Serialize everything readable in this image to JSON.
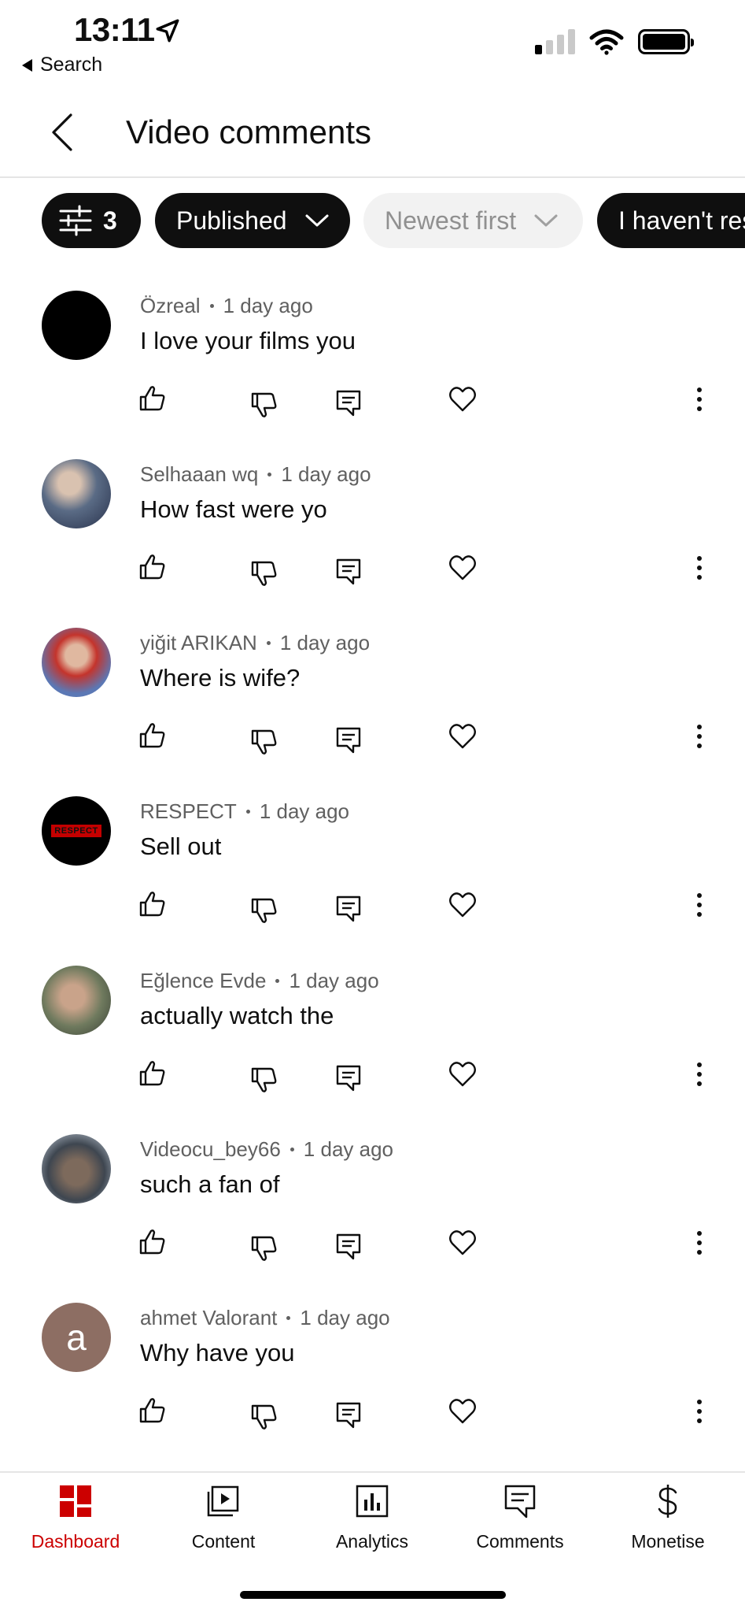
{
  "status_bar": {
    "time": "13:11",
    "back_label": "Search",
    "signal_bars_filled": 1,
    "signal_bars_total": 4,
    "battery_level": 1.0
  },
  "header": {
    "title": "Video comments",
    "back_icon": "chevron-left-icon"
  },
  "filters": {
    "filter_count": "3",
    "chips": [
      {
        "label": "Published",
        "icon": "chevron-down-icon",
        "style": "dark"
      },
      {
        "label": "Newest first",
        "icon": "chevron-down-icon",
        "style": "disabled"
      },
      {
        "label": "I haven't res",
        "style": "dark"
      }
    ]
  },
  "comments": [
    {
      "author": "Özreal",
      "time": "1 day ago",
      "text": "I love your films you",
      "avatar": "black"
    },
    {
      "author": "Selhaaan wq",
      "time": "1 day ago",
      "text": "How fast were yo",
      "avatar": "photo"
    },
    {
      "author": "yiğit ARIKAN",
      "time": "1 day ago",
      "text": "Where is wife?",
      "avatar": "photo"
    },
    {
      "author": "RESPECT",
      "time": "1 day ago",
      "text": "Sell out",
      "avatar": "logo",
      "avatar_text": "RESPECT"
    },
    {
      "author": "Eğlence Evde",
      "time": "1 day ago",
      "text": "actually watch the",
      "avatar": "photo"
    },
    {
      "author": "Videocu_bey66",
      "time": "1 day ago",
      "text": "such a fan of",
      "avatar": "photo"
    },
    {
      "author": "ahmet Valorant",
      "time": "1 day ago",
      "text": "Why have you",
      "avatar": "letter",
      "avatar_letter": "a"
    }
  ],
  "comment_actions": [
    "like-icon",
    "dislike-icon",
    "reply-icon",
    "heart-icon",
    "more-vertical-icon"
  ],
  "bottom_nav": {
    "active": "Dashboard",
    "items": [
      {
        "label": "Dashboard",
        "icon": "dashboard-icon"
      },
      {
        "label": "Content",
        "icon": "content-icon"
      },
      {
        "label": "Analytics",
        "icon": "analytics-icon"
      },
      {
        "label": "Comments",
        "icon": "comments-icon"
      },
      {
        "label": "Monetise",
        "icon": "dollar-icon"
      }
    ]
  },
  "colors": {
    "accent": "#cc0000",
    "chip_dark": "#0f0f0f",
    "chip_disabled_bg": "#f2f2f2",
    "meta_text": "#606060",
    "avatar_letter_bg": "#8d6e63"
  }
}
